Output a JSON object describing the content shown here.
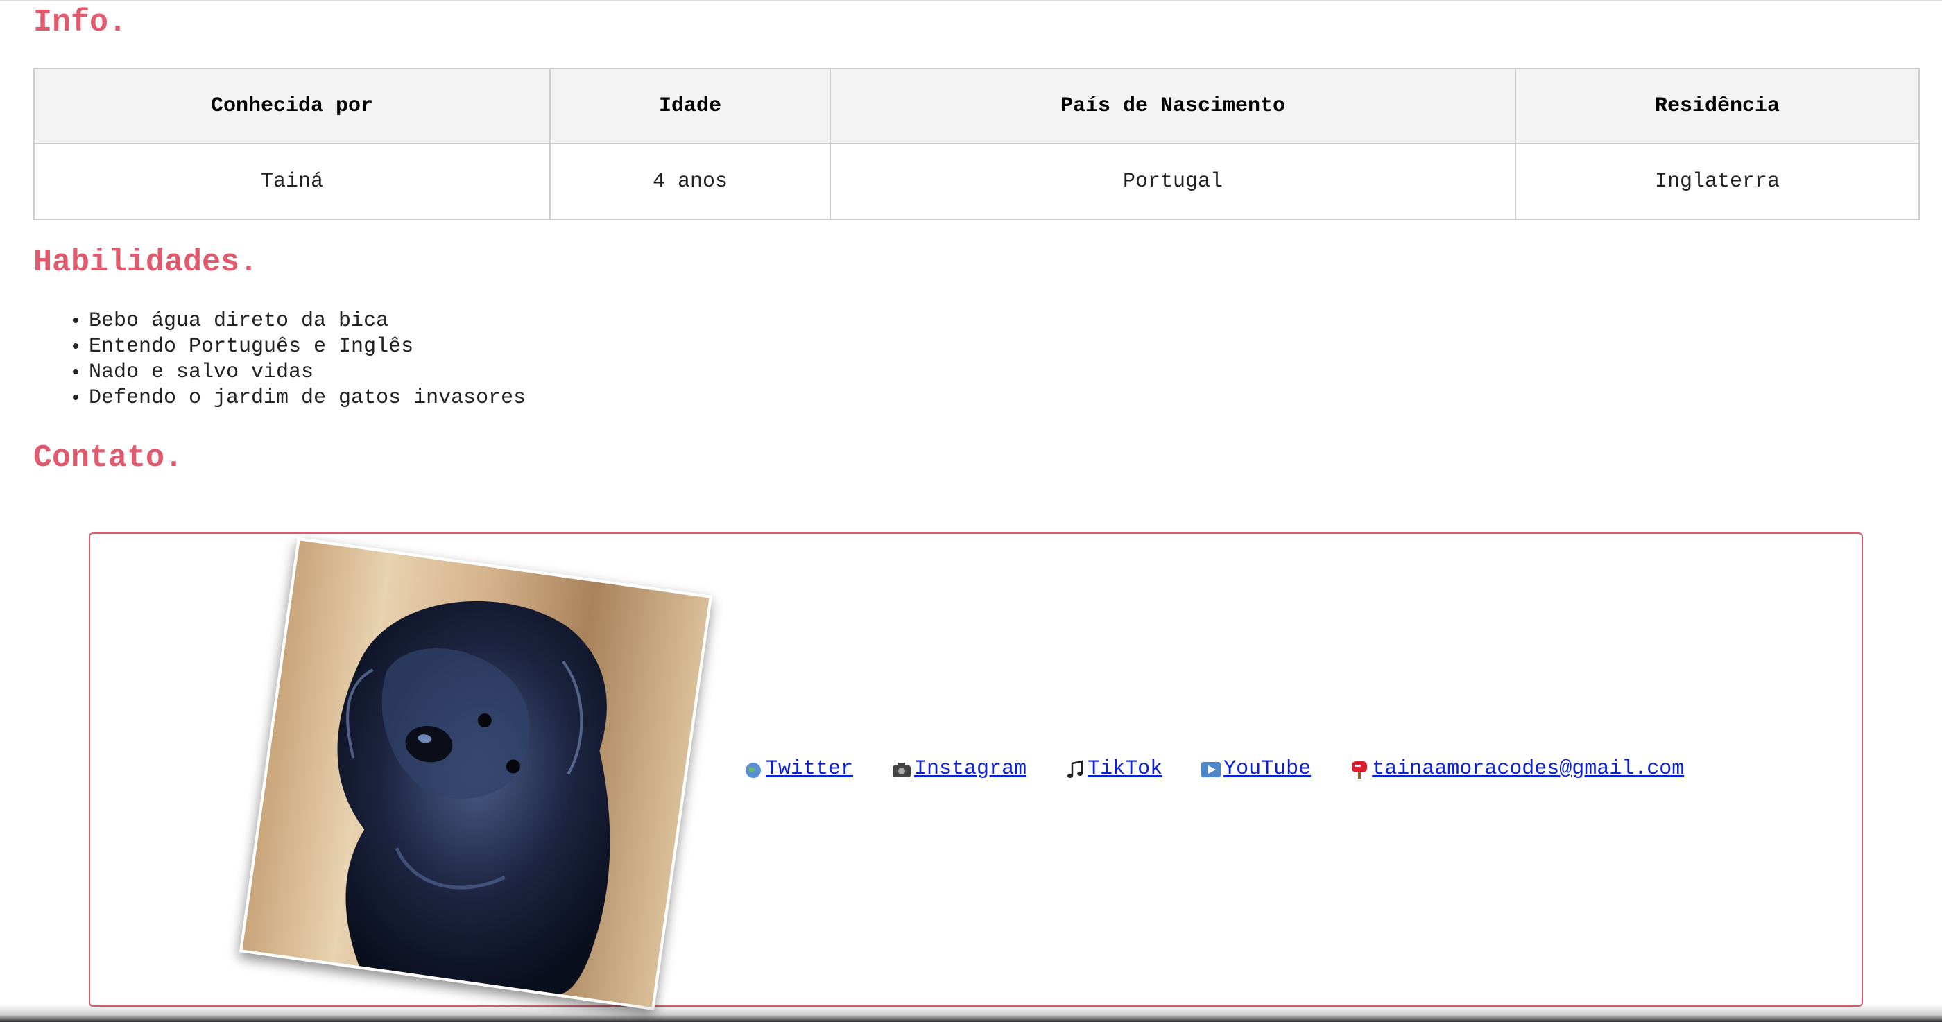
{
  "sections": {
    "info_title": "Info.",
    "skills_title": "Habilidades.",
    "contact_title": "Contato."
  },
  "info_table": {
    "headers": [
      "Conhecida por",
      "Idade",
      "País de Nascimento",
      "Residência"
    ],
    "row": [
      "Tainá",
      "4 anos",
      "Portugal",
      "Inglaterra"
    ]
  },
  "skills": [
    "Bebo água direto da bica",
    "Entendo Português e Inglês",
    "Nado e salvo vidas",
    "Defendo o jardim de gatos invasores"
  ],
  "contact": {
    "photo": "dog-photo",
    "links": [
      {
        "label": "Twitter",
        "icon": "globe-icon"
      },
      {
        "label": "Instagram",
        "icon": "camera-icon"
      },
      {
        "label": "TikTok",
        "icon": "music-note-icon"
      },
      {
        "label": "YouTube",
        "icon": "play-button-icon"
      },
      {
        "label": "tainaamoracodes@gmail.com",
        "icon": "mailbox-icon"
      }
    ]
  },
  "colors": {
    "heading": "#e05a6e",
    "link": "#0b1fd6",
    "box_border": "#e05a6e",
    "table_header_bg": "#f3f3f3"
  }
}
